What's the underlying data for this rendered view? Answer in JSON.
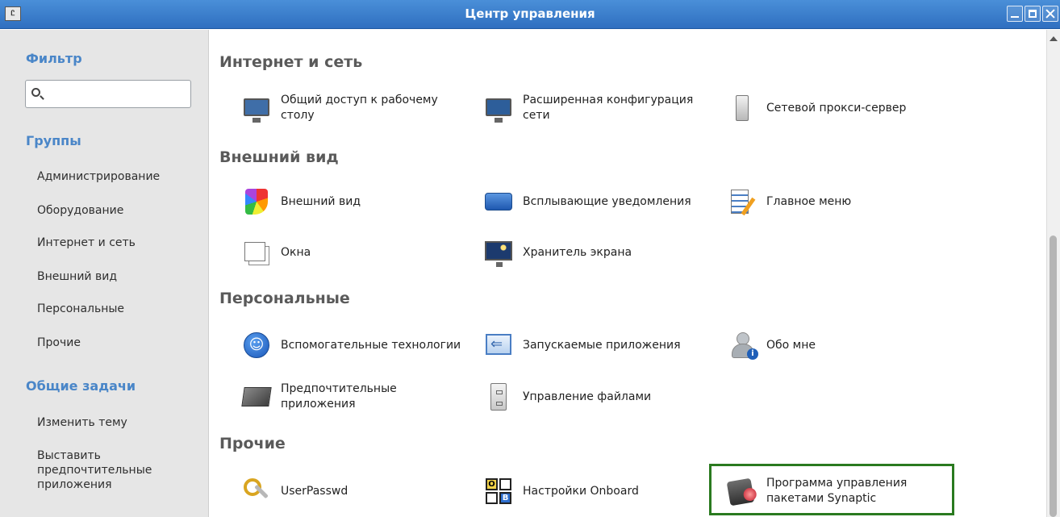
{
  "window": {
    "icon_text": "Ꮭ",
    "title": "Центр управления"
  },
  "sidebar": {
    "filter_heading": "Фильтр",
    "search_value": "",
    "search_placeholder": "",
    "groups_heading": "Группы",
    "groups": [
      {
        "label": "Администрирование"
      },
      {
        "label": "Оборудование"
      },
      {
        "label": "Интернет и сеть"
      },
      {
        "label": "Внешний вид"
      },
      {
        "label": "Персональные"
      },
      {
        "label": "Прочие"
      }
    ],
    "tasks_heading": "Общие задачи",
    "tasks": [
      {
        "label": "Изменить тему"
      },
      {
        "label": "Выставить предпочтительные приложения"
      }
    ]
  },
  "categories": [
    {
      "title": "Интернет и сеть",
      "items": [
        {
          "label": "Общий доступ к рабочему столу",
          "icon": "remote-desktop-icon"
        },
        {
          "label": "Расширенная конфигурация сети",
          "icon": "network-config-icon"
        },
        {
          "label": "Сетевой прокси-сервер",
          "icon": "proxy-server-icon"
        }
      ]
    },
    {
      "title": "Внешний вид",
      "items": [
        {
          "label": "Внешний вид",
          "icon": "appearance-icon"
        },
        {
          "label": "Всплывающие уведомления",
          "icon": "notification-icon"
        },
        {
          "label": "Главное меню",
          "icon": "main-menu-icon"
        },
        {
          "label": "Окна",
          "icon": "windows-icon"
        },
        {
          "label": "Хранитель экрана",
          "icon": "screensaver-icon"
        }
      ]
    },
    {
      "title": "Персональные",
      "items": [
        {
          "label": "Вспомогательные технологии",
          "icon": "accessibility-icon"
        },
        {
          "label": "Запускаемые приложения",
          "icon": "startup-apps-icon"
        },
        {
          "label": "Обо мне",
          "icon": "about-me-icon"
        },
        {
          "label": "Предпочтительные приложения",
          "icon": "preferred-apps-icon"
        },
        {
          "label": "Управление файлами",
          "icon": "file-management-icon"
        }
      ]
    },
    {
      "title": "Прочие",
      "items": [
        {
          "label": "UserPasswd",
          "icon": "keys-icon"
        },
        {
          "label": "Настройки Onboard",
          "icon": "onboard-keyboard-icon"
        },
        {
          "label": "Программа управления пакетами Synaptic",
          "icon": "synaptic-icon"
        }
      ]
    }
  ],
  "onboard_keys": [
    "O",
    "",
    "",
    "B"
  ],
  "colors": {
    "titlebar": "#3a7fd0",
    "sidebar_heading": "#4a86c8",
    "highlight": "#2a7a1f"
  }
}
